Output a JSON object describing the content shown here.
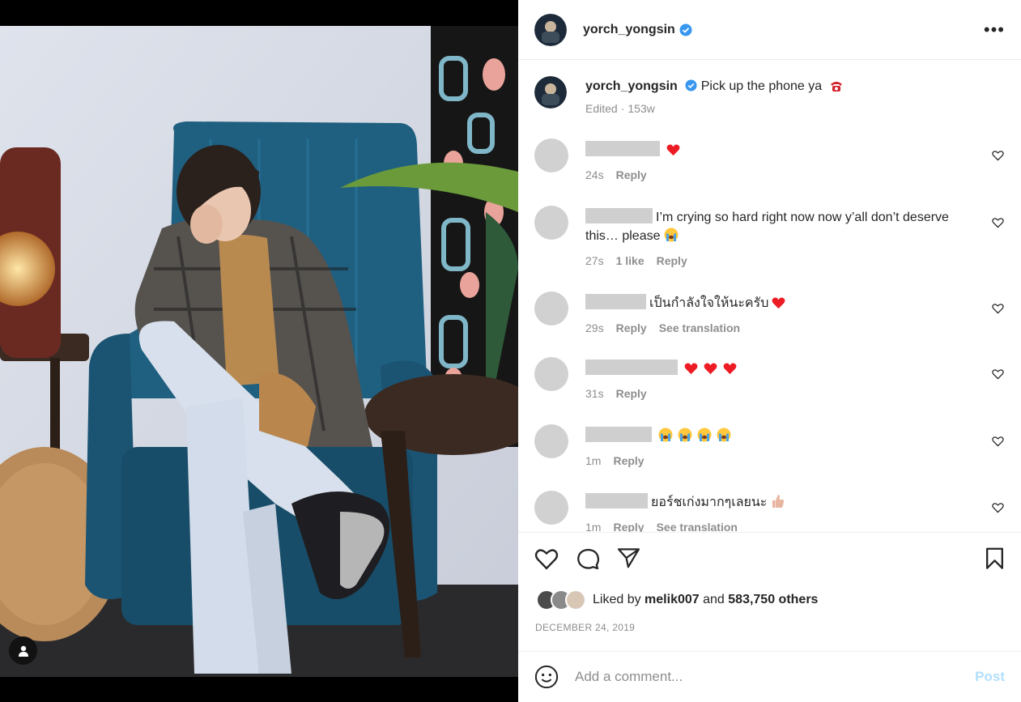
{
  "header": {
    "username": "yorch_yongsin",
    "verified": true,
    "more_icon": "more-dots-icon"
  },
  "caption": {
    "username": "yorch_yongsin",
    "text": "Pick up the phone ya",
    "emoji": "telephone-emoji",
    "edited": "Edited",
    "age": "153w"
  },
  "comments": [
    {
      "text": "",
      "emoji": [
        "heart",
        ""
      ],
      "time": "24s",
      "likes": "",
      "reply": "Reply",
      "translate": ""
    },
    {
      "text": "I’m crying so hard right now now y’all don’t deserve this… please",
      "time": "27s",
      "likes": "1 like",
      "reply": "Reply",
      "translate": ""
    },
    {
      "text": "เป็นกำลังใจให้นะครับ",
      "time": "29s",
      "likes": "",
      "reply": "Reply",
      "translate": "See translation"
    },
    {
      "text": "",
      "time": "31s",
      "likes": "",
      "reply": "Reply",
      "translate": ""
    },
    {
      "text": "",
      "time": "1m",
      "likes": "",
      "reply": "Reply",
      "translate": ""
    },
    {
      "text": "ยอร์ชเก่งมากๆเลยนะ",
      "time": "1m",
      "likes": "",
      "reply": "Reply",
      "translate": "See translation"
    }
  ],
  "likes": {
    "prefix": "Liked by",
    "first_user": "melik007",
    "joiner": "and",
    "others": "583,750 others"
  },
  "date": "DECEMBER 24, 2019",
  "add_comment": {
    "placeholder": "Add a comment...",
    "post_label": "Post"
  },
  "colors": {
    "verified": "#3897f0",
    "post_disabled": "#b2dffc",
    "heart_red": "#ed1c24",
    "chair_blue": "#1f5f80"
  }
}
